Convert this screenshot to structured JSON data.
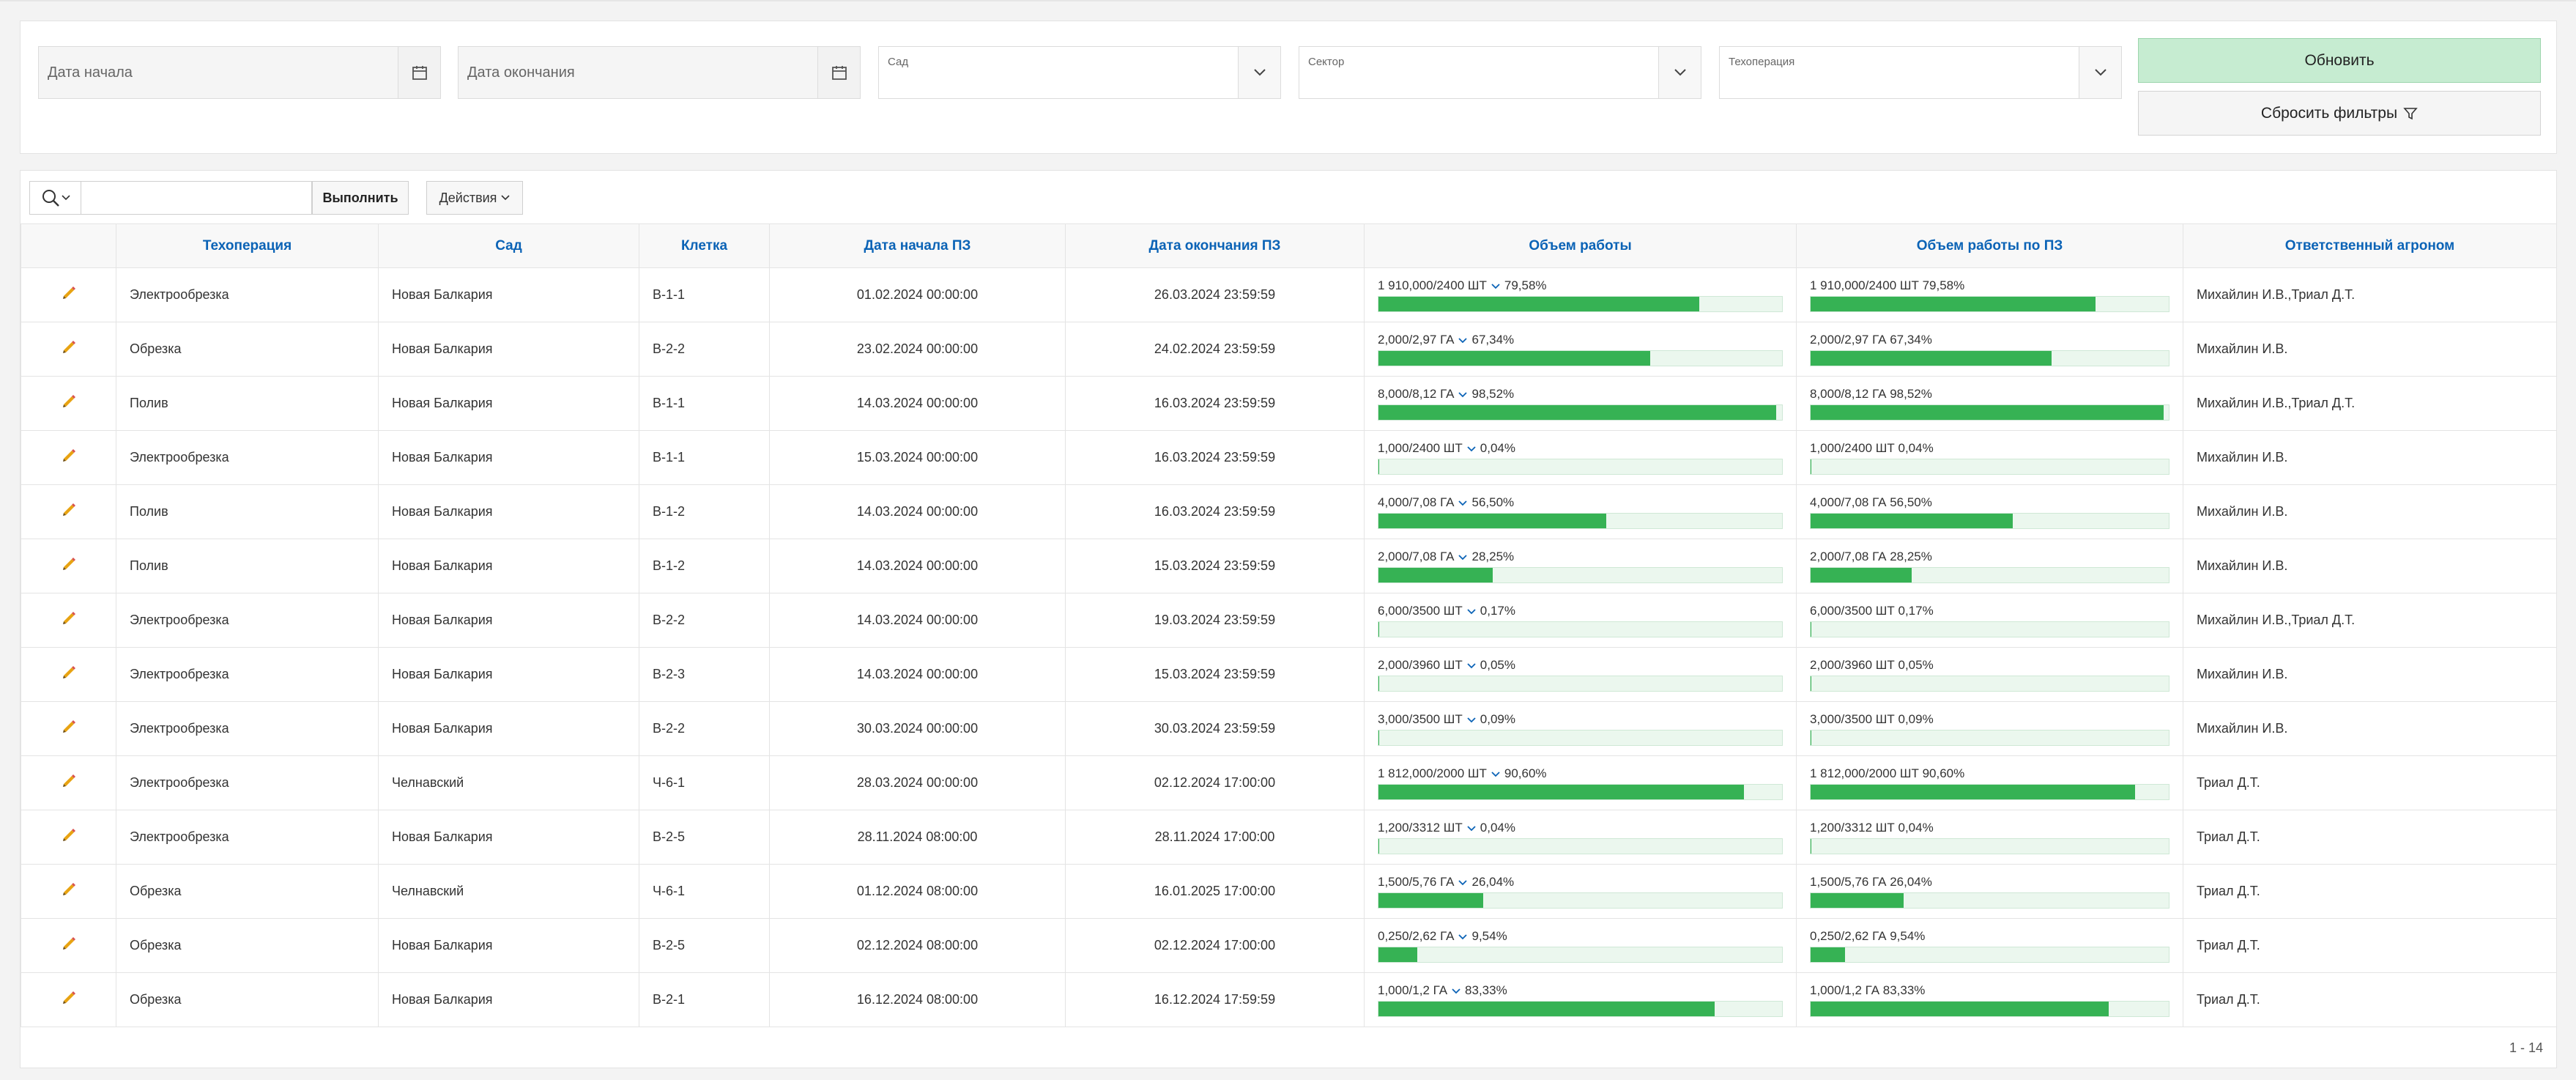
{
  "filters": {
    "date_start_placeholder": "Дата начала",
    "date_end_placeholder": "Дата окончания",
    "garden_label": "Сад",
    "sector_label": "Сектор",
    "operation_label": "Техоперация",
    "refresh_label": "Обновить",
    "reset_label": "Сбросить фильтры"
  },
  "toolbar": {
    "go_label": "Выполнить",
    "actions_label": "Действия",
    "search_value": ""
  },
  "table": {
    "columns": [
      "Техоперация",
      "Сад",
      "Клетка",
      "Дата начала ПЗ",
      "Дата окончания ПЗ",
      "Объем работы",
      "Объем работы по ПЗ",
      "Ответственный агроном"
    ],
    "rows": [
      {
        "op": "Электрообрезка",
        "garden": "Новая Балкария",
        "cell": "В-1-1",
        "start": "01.02.2024 00:00:00",
        "end": "26.03.2024 23:59:59",
        "vol": "1 910,000/2400 ШТ",
        "pct": "79,58%",
        "vol_pz": "1 910,000/2400 ШТ 79,58%",
        "agro": "Михайлин И.В.,Триал Д.Т.",
        "p": 0.7958
      },
      {
        "op": "Обрезка",
        "garden": "Новая Балкария",
        "cell": "В-2-2",
        "start": "23.02.2024 00:00:00",
        "end": "24.02.2024 23:59:59",
        "vol": "2,000/2,97 ГА",
        "pct": "67,34%",
        "vol_pz": "2,000/2,97 ГА 67,34%",
        "agro": "Михайлин И.В.",
        "p": 0.6734
      },
      {
        "op": "Полив",
        "garden": "Новая Балкария",
        "cell": "В-1-1",
        "start": "14.03.2024 00:00:00",
        "end": "16.03.2024 23:59:59",
        "vol": "8,000/8,12 ГА",
        "pct": "98,52%",
        "vol_pz": "8,000/8,12 ГА 98,52%",
        "agro": "Михайлин И.В.,Триал Д.Т.",
        "p": 0.9852
      },
      {
        "op": "Электрообрезка",
        "garden": "Новая Балкария",
        "cell": "В-1-1",
        "start": "15.03.2024 00:00:00",
        "end": "16.03.2024 23:59:59",
        "vol": "1,000/2400 ШТ",
        "pct": "0,04%",
        "vol_pz": "1,000/2400 ШТ 0,04%",
        "agro": "Михайлин И.В.",
        "p": 0.0004
      },
      {
        "op": "Полив",
        "garden": "Новая Балкария",
        "cell": "В-1-2",
        "start": "14.03.2024 00:00:00",
        "end": "16.03.2024 23:59:59",
        "vol": "4,000/7,08 ГА",
        "pct": "56,50%",
        "vol_pz": "4,000/7,08 ГА 56,50%",
        "agro": "Михайлин И.В.",
        "p": 0.565
      },
      {
        "op": "Полив",
        "garden": "Новая Балкария",
        "cell": "В-1-2",
        "start": "14.03.2024 00:00:00",
        "end": "15.03.2024 23:59:59",
        "vol": "2,000/7,08 ГА",
        "pct": "28,25%",
        "vol_pz": "2,000/7,08 ГА 28,25%",
        "agro": "Михайлин И.В.",
        "p": 0.2825
      },
      {
        "op": "Электрообрезка",
        "garden": "Новая Балкария",
        "cell": "В-2-2",
        "start": "14.03.2024 00:00:00",
        "end": "19.03.2024 23:59:59",
        "vol": "6,000/3500 ШТ",
        "pct": "0,17%",
        "vol_pz": "6,000/3500 ШТ 0,17%",
        "agro": "Михайлин И.В.,Триал Д.Т.",
        "p": 0.0017
      },
      {
        "op": "Электрообрезка",
        "garden": "Новая Балкария",
        "cell": "В-2-3",
        "start": "14.03.2024 00:00:00",
        "end": "15.03.2024 23:59:59",
        "vol": "2,000/3960 ШТ",
        "pct": "0,05%",
        "vol_pz": "2,000/3960 ШТ 0,05%",
        "agro": "Михайлин И.В.",
        "p": 0.0005
      },
      {
        "op": "Электрообрезка",
        "garden": "Новая Балкария",
        "cell": "В-2-2",
        "start": "30.03.2024 00:00:00",
        "end": "30.03.2024 23:59:59",
        "vol": "3,000/3500 ШТ",
        "pct": "0,09%",
        "vol_pz": "3,000/3500 ШТ 0,09%",
        "agro": "Михайлин И.В.",
        "p": 0.0009
      },
      {
        "op": "Электрообрезка",
        "garden": "Челнавский",
        "cell": "Ч-6-1",
        "start": "28.03.2024 00:00:00",
        "end": "02.12.2024 17:00:00",
        "vol": "1 812,000/2000 ШТ",
        "pct": "90,60%",
        "vol_pz": "1 812,000/2000 ШТ 90,60%",
        "agro": "Триал Д.Т.",
        "p": 0.906
      },
      {
        "op": "Электрообрезка",
        "garden": "Новая Балкария",
        "cell": "В-2-5",
        "start": "28.11.2024 08:00:00",
        "end": "28.11.2024 17:00:00",
        "vol": "1,200/3312 ШТ",
        "pct": "0,04%",
        "vol_pz": "1,200/3312 ШТ 0,04%",
        "agro": "Триал Д.Т.",
        "p": 0.0004
      },
      {
        "op": "Обрезка",
        "garden": "Челнавский",
        "cell": "Ч-6-1",
        "start": "01.12.2024 08:00:00",
        "end": "16.01.2025 17:00:00",
        "vol": "1,500/5,76 ГА",
        "pct": "26,04%",
        "vol_pz": "1,500/5,76 ГА 26,04%",
        "agro": "Триал Д.Т.",
        "p": 0.2604
      },
      {
        "op": "Обрезка",
        "garden": "Новая Балкария",
        "cell": "В-2-5",
        "start": "02.12.2024 08:00:00",
        "end": "02.12.2024 17:00:00",
        "vol": "0,250/2,62 ГА",
        "pct": "9,54%",
        "vol_pz": "0,250/2,62 ГА 9,54%",
        "agro": "Триал Д.Т.",
        "p": 0.0954
      },
      {
        "op": "Обрезка",
        "garden": "Новая Балкария",
        "cell": "В-2-1",
        "start": "16.12.2024 08:00:00",
        "end": "16.12.2024 17:59:59",
        "vol": "1,000/1,2 ГА",
        "pct": "83,33%",
        "vol_pz": "1,000/1,2 ГА 83,33%",
        "agro": "Триал Д.Т.",
        "p": 0.8333
      }
    ]
  },
  "pagination": {
    "range": "1 - 14"
  },
  "colors": {
    "accent_link": "#0b63b6",
    "progress": "#36b254",
    "refresh_bg": "#c6ecd1",
    "edit_icon": "#e8a312"
  },
  "icons": [
    "calendar-icon",
    "chevron-down-icon",
    "search-icon",
    "filter-icon",
    "pencil-icon"
  ]
}
